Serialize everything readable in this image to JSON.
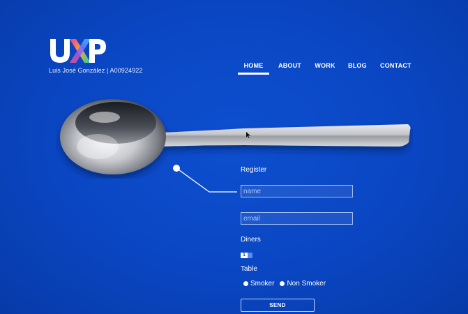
{
  "brand": {
    "logo_text": "UXP",
    "author": "Luis José González | A00924922"
  },
  "nav": {
    "items": [
      {
        "label": "HOME",
        "active": true
      },
      {
        "label": "ABOUT",
        "active": false
      },
      {
        "label": "WORK",
        "active": false
      },
      {
        "label": "BLOG",
        "active": false
      },
      {
        "label": "CONTACT",
        "active": false
      }
    ]
  },
  "form": {
    "title": "Register",
    "name_placeholder": "name",
    "email_placeholder": "email",
    "diners_label": "Diners",
    "diners_value": "1",
    "table_label": "Table",
    "table_options": [
      "Smoker",
      "Non Smoker"
    ],
    "send_label": "SEND"
  },
  "colors": {
    "background": "#0a46c2",
    "text": "#ffffff"
  }
}
